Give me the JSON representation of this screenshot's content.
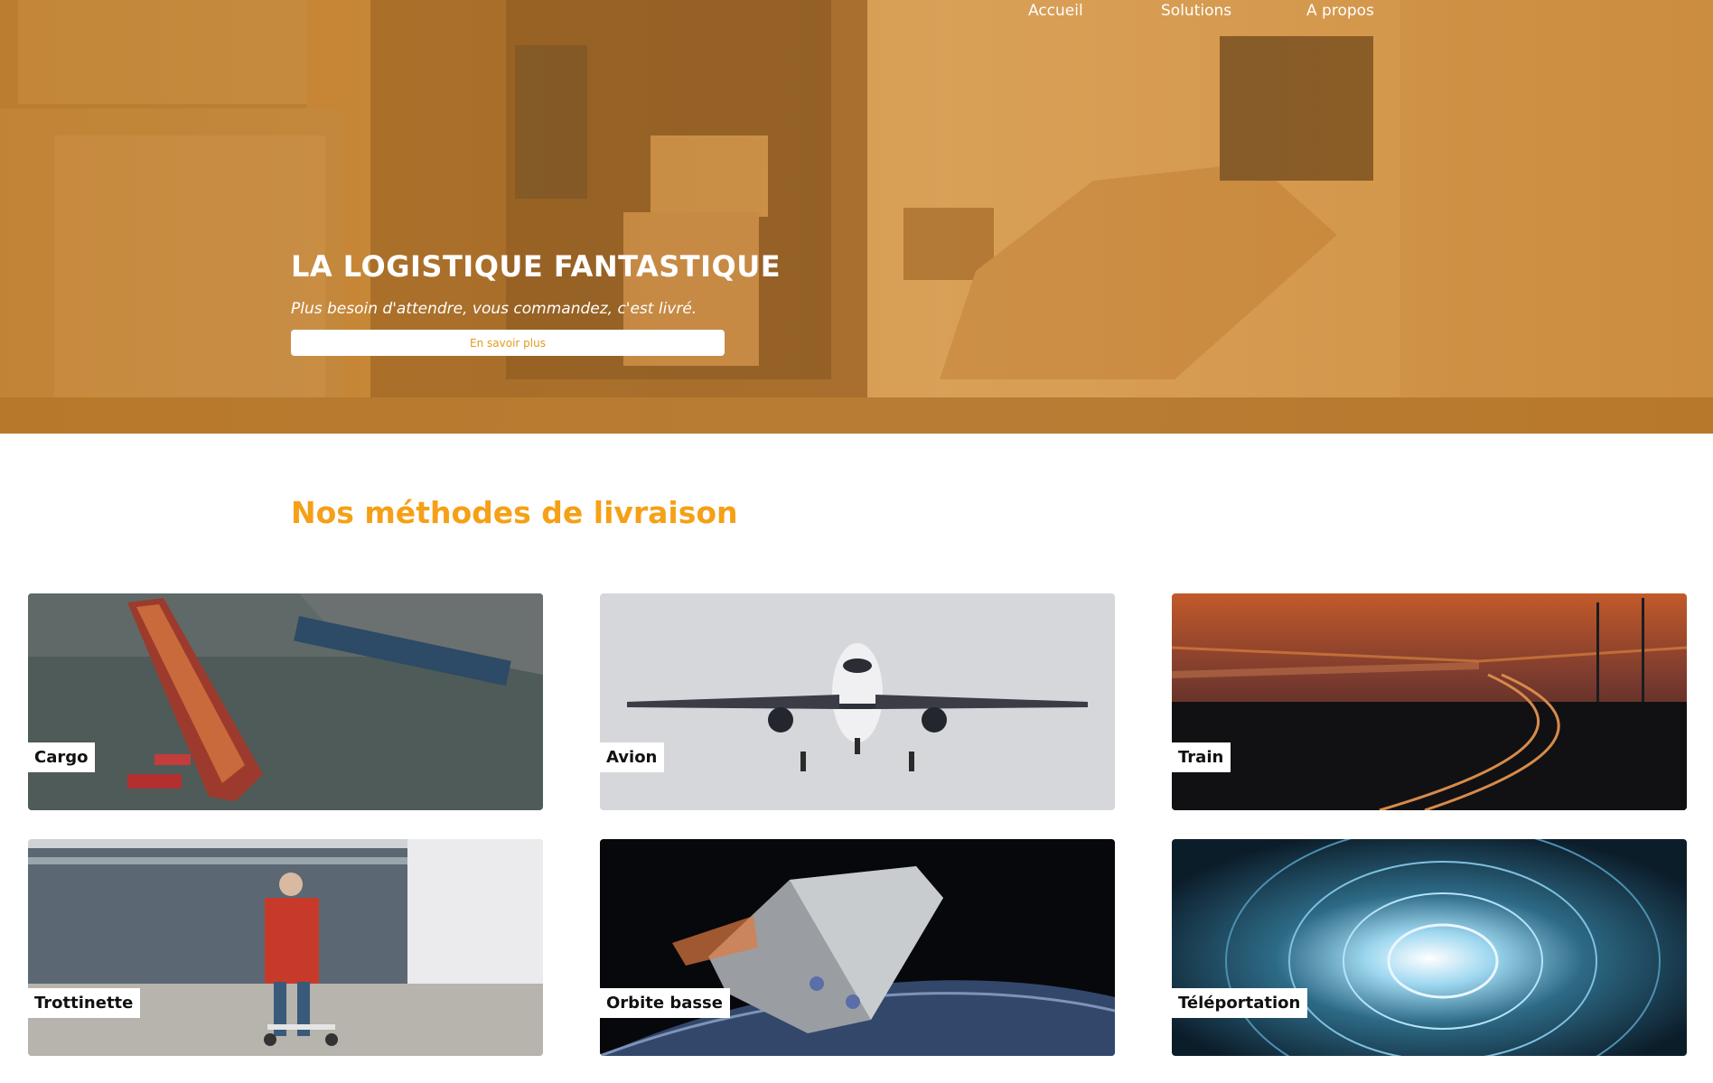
{
  "nav": {
    "items": [
      {
        "label": "Accueil"
      },
      {
        "label": "Solutions"
      },
      {
        "label": "A propos"
      }
    ]
  },
  "hero": {
    "title": "LA LOGISTIQUE FANTASTIQUE",
    "subtitle": "Plus besoin d'attendre, vous commandez, c'est livré.",
    "button_label": "En savoir plus"
  },
  "section": {
    "title": "Nos méthodes de livraison"
  },
  "methods": [
    {
      "label": "Cargo"
    },
    {
      "label": "Avion"
    },
    {
      "label": "Train"
    },
    {
      "label": "Trottinette"
    },
    {
      "label": "Orbite basse"
    },
    {
      "label": "Téléportation"
    }
  ],
  "colors": {
    "accent": "#f5a016",
    "hero_tint": "#c98b3b"
  }
}
